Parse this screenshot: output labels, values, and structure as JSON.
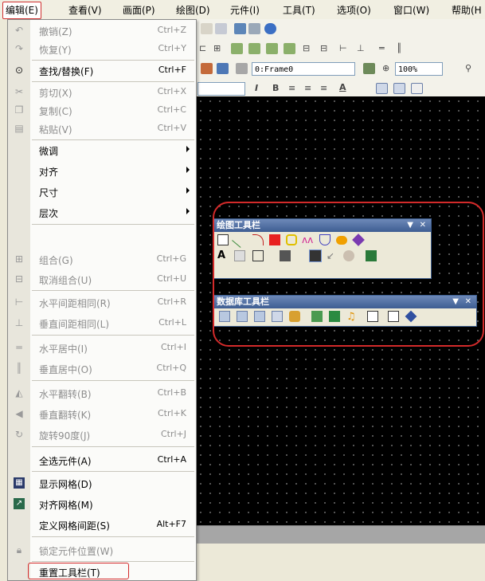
{
  "menubar": {
    "items": [
      "编辑(E)",
      "查看(V)",
      "画面(P)",
      "绘图(D)",
      "元件(I)",
      "工具(T)",
      "选项(O)",
      "窗口(W)",
      "帮助(H"
    ]
  },
  "toolbar": {
    "frame_combo": "0:Frame0",
    "zoom_combo": "100%",
    "format_buttons": [
      "I",
      "B",
      "A"
    ]
  },
  "drawing_toolbar": {
    "title": "绘图工具栏",
    "text_tool": "A"
  },
  "database_toolbar": {
    "title": "数据库工具栏"
  },
  "edit_menu": {
    "items": [
      {
        "label": "撤销(Z)",
        "shortcut": "Ctrl+Z",
        "icon": "undo-icon"
      },
      {
        "label": "恢复(Y)",
        "shortcut": "Ctrl+Y",
        "icon": "redo-icon"
      },
      {
        "label": "查找/替换(F)",
        "shortcut": "Ctrl+F",
        "icon": "binoculars-icon"
      },
      {
        "label": "剪切(X)",
        "shortcut": "Ctrl+X",
        "icon": "scissors-icon"
      },
      {
        "label": "复制(C)",
        "shortcut": "Ctrl+C",
        "icon": "copy-icon"
      },
      {
        "label": "粘贴(V)",
        "shortcut": "Ctrl+V",
        "icon": "paste-icon"
      },
      {
        "label": "微调",
        "shortcut": "",
        "icon": ""
      },
      {
        "label": "对齐",
        "shortcut": "",
        "icon": ""
      },
      {
        "label": "尺寸",
        "shortcut": "",
        "icon": ""
      },
      {
        "label": "层次",
        "shortcut": "",
        "icon": ""
      },
      {
        "label": "组合(G)",
        "shortcut": "Ctrl+G",
        "icon": "group-icon"
      },
      {
        "label": "取消组合(U)",
        "shortcut": "Ctrl+U",
        "icon": "ungroup-icon"
      },
      {
        "label": "水平间距相同(R)",
        "shortcut": "Ctrl+R",
        "icon": "horizontal-spacing-icon"
      },
      {
        "label": "垂直间距相同(L)",
        "shortcut": "Ctrl+L",
        "icon": "vertical-spacing-icon"
      },
      {
        "label": "水平居中(I)",
        "shortcut": "Ctrl+I",
        "icon": "center-horizontal-icon"
      },
      {
        "label": "垂直居中(O)",
        "shortcut": "Ctrl+Q",
        "icon": "center-vertical-icon"
      },
      {
        "label": "水平翻转(B)",
        "shortcut": "Ctrl+B",
        "icon": "flip-horizontal-icon"
      },
      {
        "label": "垂直翻转(K)",
        "shortcut": "Ctrl+K",
        "icon": "flip-vertical-icon"
      },
      {
        "label": "旋转90度(J)",
        "shortcut": "Ctrl+J",
        "icon": "rotate-icon"
      },
      {
        "label": "全选元件(A)",
        "shortcut": "Ctrl+A",
        "icon": ""
      },
      {
        "label": "显示网格(D)",
        "shortcut": "",
        "icon": "grid-icon"
      },
      {
        "label": "对齐网格(M)",
        "shortcut": "",
        "icon": "snap-grid-icon"
      },
      {
        "label": "定义网格间距(S)",
        "shortcut": "Alt+F7",
        "icon": ""
      },
      {
        "label": "锁定元件位置(W)",
        "shortcut": "",
        "icon": "lock-icon"
      },
      {
        "label": "重置工具栏(T)",
        "shortcut": "",
        "icon": ""
      }
    ]
  },
  "colors": {
    "highlight": "#d32a2a",
    "disabled_text": "#8d8d8d",
    "palette_title": "#3e5d92",
    "canvas": "#000000"
  }
}
